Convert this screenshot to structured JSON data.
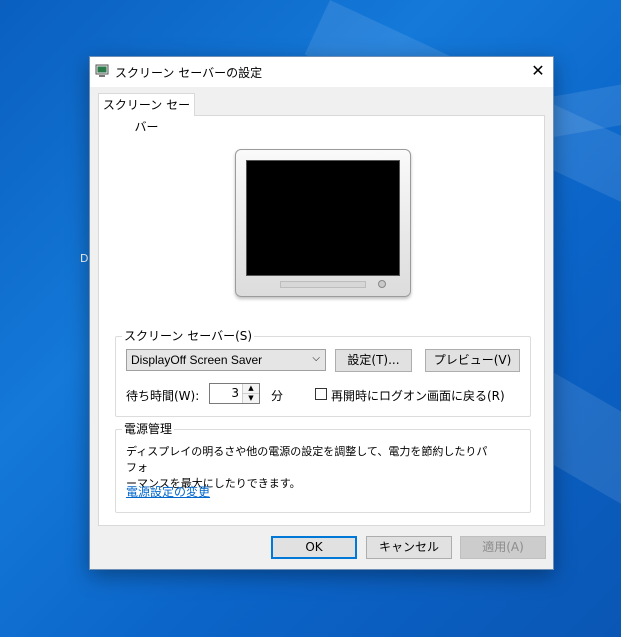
{
  "desktop": {
    "partial_icon_label": "D"
  },
  "dialog": {
    "title": "スクリーン セーバーの設定",
    "close_glyph": "✕",
    "tab_label": "スクリーン セーバー"
  },
  "screensaver": {
    "group_label": "スクリーン セーバー(S)",
    "selected": "DisplayOff Screen Saver",
    "settings_button": "設定(T)...",
    "preview_button": "プレビュー(V)",
    "wait_label": "待ち時間(W):",
    "wait_value": "3",
    "minutes_label": "分",
    "resume_logon_label": "再開時にログオン画面に戻る(R)",
    "resume_logon_checked": false
  },
  "power": {
    "group_label": "電源管理",
    "description_line1": "ディスプレイの明るさや他の電源の設定を調整して、電力を節約したりパフォ",
    "description_line2": "ーマンスを最大にしたりできます。",
    "link": "電源設定の変更"
  },
  "footer": {
    "ok": "OK",
    "cancel": "キャンセル",
    "apply": "適用(A)"
  },
  "icons": {
    "dropdown": "chevron-down-icon",
    "spin_up": "spin-up-icon",
    "spin_down": "spin-down-icon"
  }
}
